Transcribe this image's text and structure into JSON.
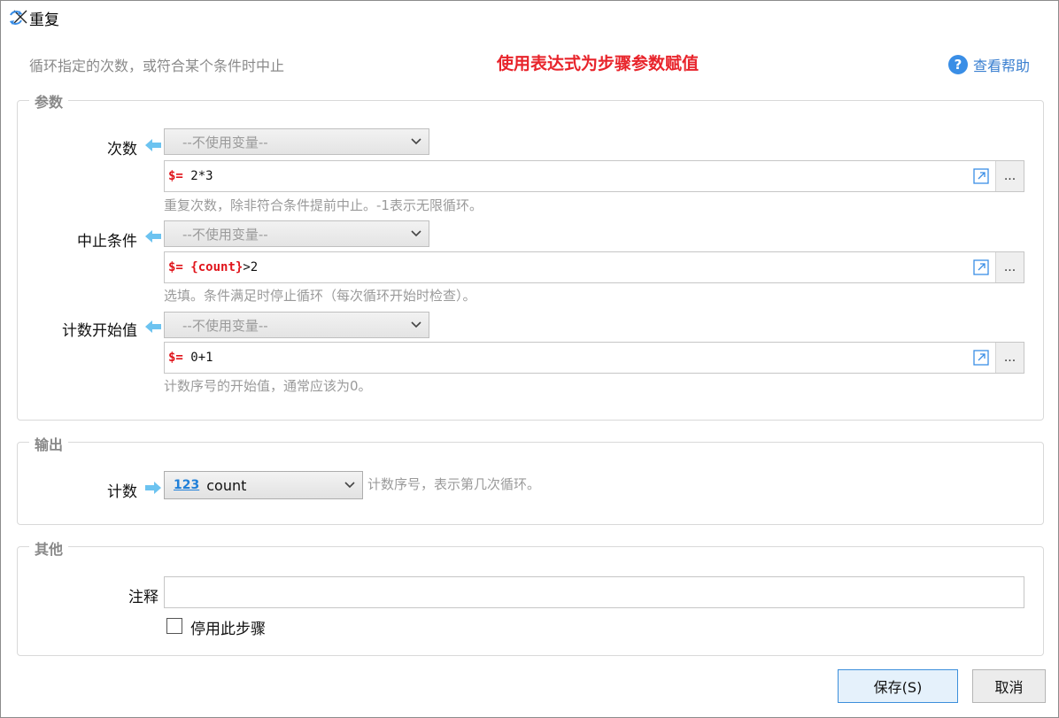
{
  "window": {
    "title": "重复"
  },
  "header": {
    "subtitle": "循环指定的次数，或符合某个条件时中止",
    "headline": "使用表达式为步骤参数赋值",
    "help_label": "查看帮助",
    "help_glyph": "?"
  },
  "params": {
    "legend": "参数",
    "fields": [
      {
        "label": "次数",
        "variable_placeholder": "--不使用变量--",
        "expr_prefix": "$=",
        "expr_var": "",
        "expr_value": "2*3",
        "hint": "重复次数，除非符合条件提前中止。-1表示无限循环。"
      },
      {
        "label": "中止条件",
        "variable_placeholder": "--不使用变量--",
        "expr_prefix": "$=",
        "expr_var": "{count}",
        "expr_value": ">2",
        "hint": "选填。条件满足时停止循环（每次循环开始时检查）。"
      },
      {
        "label": "计数开始值",
        "variable_placeholder": "--不使用变量--",
        "expr_prefix": "$=",
        "expr_var": "",
        "expr_value": "0+1",
        "hint": "计数序号的开始值，通常应该为0。"
      }
    ],
    "more_label": "..."
  },
  "output": {
    "legend": "输出",
    "label": "计数",
    "type_glyph": "123",
    "variable": "count",
    "hint": "计数序号，表示第几次循环。"
  },
  "other": {
    "legend": "其他",
    "comment_label": "注释",
    "comment_value": "",
    "disable_label": "停用此步骤",
    "disable_checked": false
  },
  "footer": {
    "save_label": "保存(S)",
    "cancel_label": "取消"
  },
  "colors": {
    "accent": "#3a8ee6",
    "headline": "#e8242b",
    "expr_prefix": "#e0141b",
    "arrow": "#6cc3f0"
  }
}
